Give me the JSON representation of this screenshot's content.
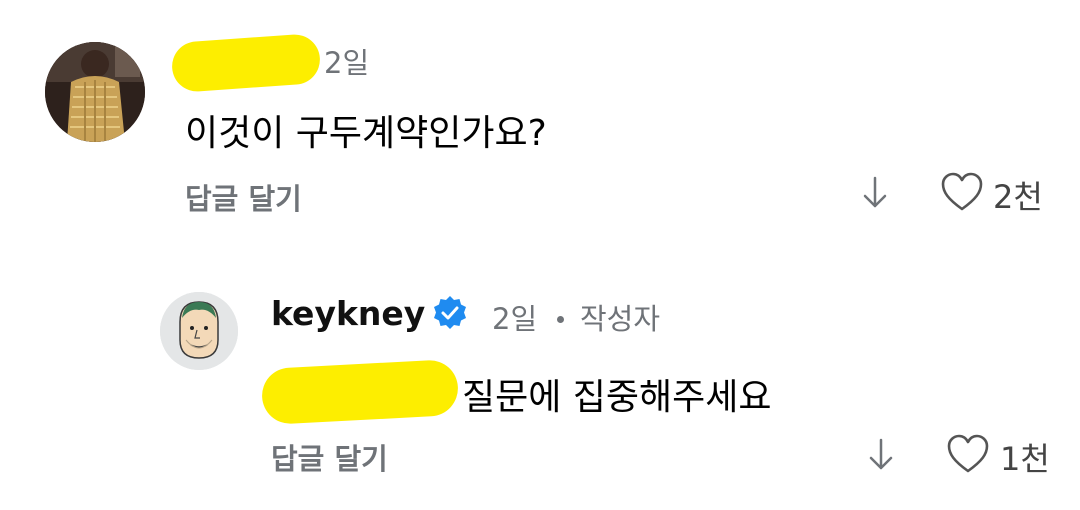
{
  "comments": [
    {
      "time": "2일",
      "text": "이것이 구두계약인가요?",
      "reply_label": "답글 달기",
      "like_count": "2천"
    },
    {
      "username": "keykney",
      "time": "2일",
      "author_tag": "작성자",
      "text": "질문에 집중해주세요",
      "reply_label": "답글 달기",
      "like_count": "1천"
    }
  ],
  "colors": {
    "redaction": "#fdee00",
    "secondary_text": "#6f7378",
    "verified_badge": "#1f8bf0"
  },
  "icons": [
    "arrow-down-icon",
    "heart-icon",
    "verified-badge-icon"
  ]
}
